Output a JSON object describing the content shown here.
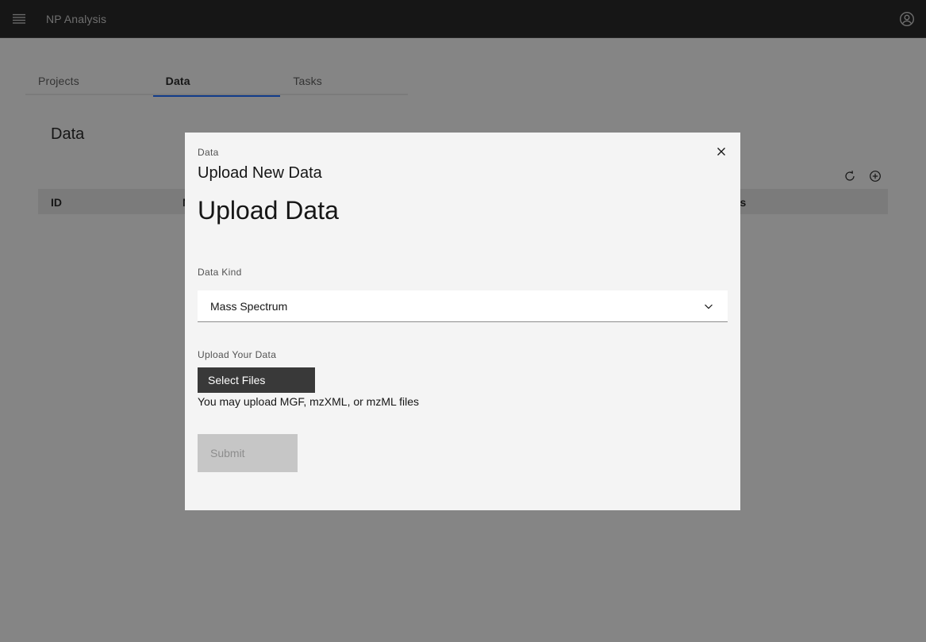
{
  "header": {
    "app_name": "NP Analysis",
    "menu_icon": "hamburger-menu-icon",
    "user_icon": "user-avatar-icon",
    "background": "#161616"
  },
  "tabs": [
    {
      "label": "Projects",
      "active": false
    },
    {
      "label": "Data",
      "active": true
    },
    {
      "label": "Tasks",
      "active": false
    }
  ],
  "panel": {
    "title": "Data",
    "toolbar": {
      "refresh_icon": "refresh-icon",
      "add_icon": "add-circle-icon"
    },
    "columns": [
      "ID",
      "N",
      "us"
    ]
  },
  "modal": {
    "label": "Data",
    "heading": "Upload New Data",
    "close_icon": "close-icon",
    "form_title": "Upload Data",
    "data_kind": {
      "label": "Data Kind",
      "selected": "Mass Spectrum",
      "icon": "chevron-down-icon"
    },
    "upload": {
      "label": "Upload Your Data",
      "button_label": "Select Files",
      "helper_text": "You may upload MGF, mzXML, or mzML files"
    },
    "submit_label": "Submit",
    "submit_disabled": true
  },
  "colors": {
    "accent": "#0f62fe",
    "overlay": "rgba(22,22,22,0.5)",
    "disabled_button": "#c6c6c6",
    "file_button": "#393939"
  }
}
